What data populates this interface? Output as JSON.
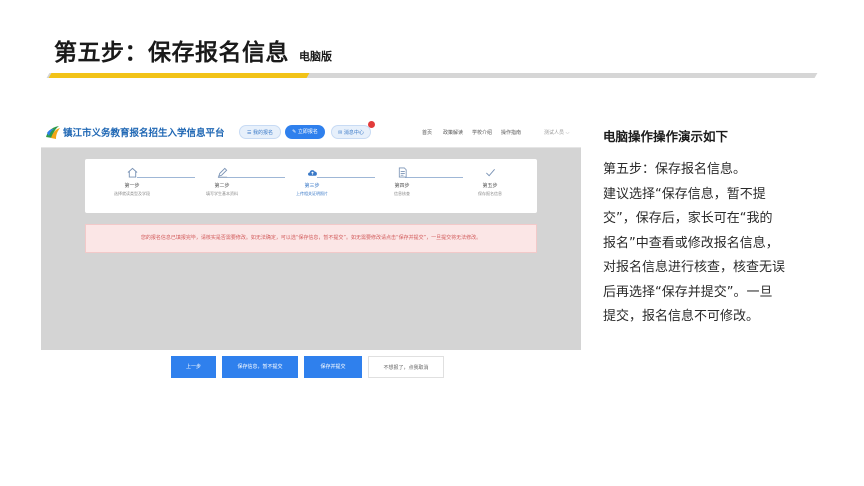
{
  "slide": {
    "title": "第五步：保存报名信息",
    "subtitle": "电脑版"
  },
  "screenshot": {
    "site_name": "镇江市义务教育报名招生入学信息平台",
    "pills": [
      {
        "label": "☰ 我的报名",
        "style": "light"
      },
      {
        "label": "✎ 立即报名",
        "style": "solid"
      },
      {
        "label": "✉ 消息中心",
        "style": "light"
      }
    ],
    "nav": [
      "首页",
      "政策解读",
      "学校介绍",
      "操作指南"
    ],
    "user_menu": "测试人员 ⌵",
    "steps": [
      {
        "number": "第一步",
        "desc": "选择就读类型及学段",
        "icon": "home-icon"
      },
      {
        "number": "第二步",
        "desc": "填写学生基本资料",
        "icon": "pencil-icon"
      },
      {
        "number": "第三步",
        "desc": "上传相关证明照片",
        "icon": "cloud-upload-icon"
      },
      {
        "number": "第四步",
        "desc": "信息核查",
        "icon": "document-icon"
      },
      {
        "number": "第五步",
        "desc": "保存报名信息",
        "icon": "check-icon"
      }
    ],
    "current_step": 3,
    "notice": "您的报名信息已填报完毕，请核实是否需要修改。如无法确定，可以选“保存信息，暂不提交”。如无需要修改请点击“保存并提交”，一旦提交将无法修改。",
    "buttons": [
      {
        "label": "上一步",
        "style": "blue"
      },
      {
        "label": "保存信息，暂不提交",
        "style": "blue"
      },
      {
        "label": "保存并提交",
        "style": "blue"
      },
      {
        "label": "不想报了，点我取消",
        "style": "plain"
      }
    ]
  },
  "explanation": {
    "heading": "电脑操作操作演示如下",
    "lines": [
      "第五步：保存报名信息。",
      "建议选择“保存信息，暂不提",
      "交”，保存后，家长可在“我的",
      "报名”中查看或修改报名信息，",
      "对报名信息进行核查，核查无误",
      "后再选择“保存并提交”。一旦",
      "提交，报名信息不可修改。"
    ]
  },
  "colors": {
    "accent_blue": "#2f80ed",
    "accent_yellow": "#f2c318",
    "notice_red": "#d25b5b"
  }
}
